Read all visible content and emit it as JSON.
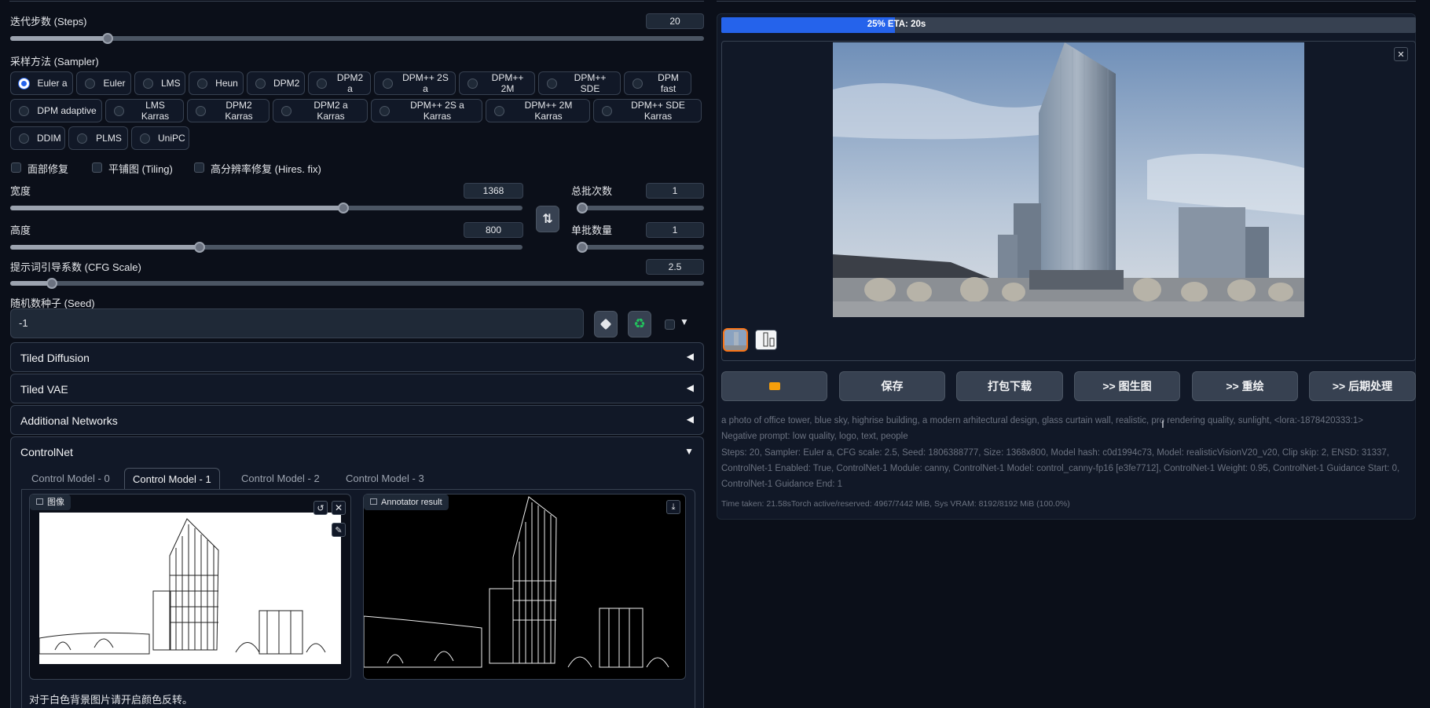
{
  "steps": {
    "label": "迭代步数 (Steps)",
    "value": "20",
    "fraction": 0.14
  },
  "sampler": {
    "label": "采样方法 (Sampler)",
    "selected": "Euler a",
    "row1": [
      "Euler a",
      "Euler",
      "LMS",
      "Heun",
      "DPM2",
      "DPM2 a",
      "DPM++ 2S a",
      "DPM++ 2M",
      "DPM++ SDE",
      "DPM fast"
    ],
    "row2": [
      "DPM adaptive",
      "LMS Karras",
      "DPM2 Karras",
      "DPM2 a Karras",
      "DPM++ 2S a Karras",
      "DPM++ 2M Karras",
      "DPM++ SDE Karras"
    ],
    "row3": [
      "DDIM",
      "PLMS",
      "UniPC"
    ]
  },
  "options": {
    "face_restore": "面部修复",
    "tiling": "平铺图 (Tiling)",
    "hires": "高分辨率修复 (Hires. fix)"
  },
  "width": {
    "label": "宽度",
    "value": "1368",
    "fraction": 0.65
  },
  "height": {
    "label": "高度",
    "value": "800",
    "fraction": 0.37
  },
  "batch_count": {
    "label": "总批次数",
    "value": "1",
    "fraction": 0.0
  },
  "batch_size": {
    "label": "单批数量",
    "value": "1",
    "fraction": 0.0
  },
  "cfg": {
    "label": "提示词引导系数 (CFG Scale)",
    "value": "2.5",
    "fraction": 0.06
  },
  "seed": {
    "label": "随机数种子 (Seed)",
    "value": "-1"
  },
  "accordions": {
    "tiled_diffusion": "Tiled Diffusion",
    "tiled_vae": "Tiled VAE",
    "additional_networks": "Additional Networks",
    "controlnet": "ControlNet"
  },
  "controlnet_tabs": [
    "Control Model - 0",
    "Control Model - 1",
    "Control Model - 2",
    "Control Model - 3"
  ],
  "controlnet_active_tab": "Control Model - 1",
  "image_panel_label": "图像",
  "annotator_label": "Annotator result",
  "invert_note": "对于白色背景图片请开启颜色反转。",
  "progress": {
    "text": "25% ETA: 20s",
    "fraction": 0.25
  },
  "buttons": {
    "save": "保存",
    "zip": "打包下载",
    "img2img": ">> 图生图",
    "inpaint": ">> 重绘",
    "extras": ">> 后期处理"
  },
  "info": {
    "prompt": "a photo of office tower, blue sky, highrise building, a modern arhitectural design, glass curtain wall, realistic, pro rendering quality, sunlight, <lora:-1878420333:1>",
    "negative": "Negative prompt: low quality, logo, text, people",
    "params1": "Steps: 20, Sampler: Euler a, CFG scale: 2.5, Seed: 1806388777, Size: 1368x800, Model hash: c0d1994c73, Model: realisticVisionV20_v20, Clip skip: 2, ENSD: 31337,",
    "params2": "ControlNet-1 Enabled: True, ControlNet-1 Module: canny, ControlNet-1 Model: control_canny-fp16 [e3fe7712], ControlNet-1 Weight: 0.95, ControlNet-1 Guidance Start: 0,",
    "params3": "ControlNet-1 Guidance End: 1",
    "timing": "Time taken: 21.58sTorch active/reserved: 4967/7442 MiB, Sys VRAM: 8192/8192 MiB (100.0%)"
  },
  "colors": {
    "accent": "#2563eb",
    "thumb_selected_border": "#f97316",
    "background": "#0b0f19"
  }
}
